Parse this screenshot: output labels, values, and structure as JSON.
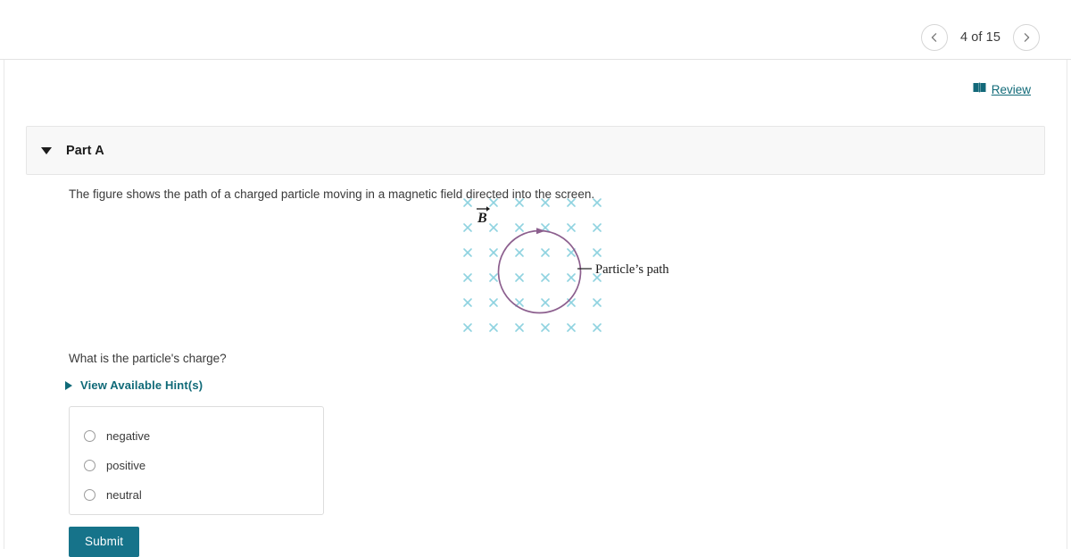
{
  "pager": {
    "prev_icon": "chevron-left-icon",
    "next_icon": "chevron-right-icon",
    "label": "4 of 15",
    "current": 4,
    "total": 15
  },
  "review": {
    "icon": "book-icon",
    "label": "Review"
  },
  "part": {
    "caret_icon": "caret-down-icon",
    "title": "Part A"
  },
  "question": {
    "statement": "The figure shows the path of a charged particle moving in a magnetic field directed into the screen.",
    "prompt": "What is the particle's charge?"
  },
  "hint": {
    "caret_icon": "caret-right-icon",
    "label": "View Available Hint(s)"
  },
  "figure": {
    "field_label": "B",
    "path_label": "Particle's path",
    "field_symbol": "×",
    "field_direction": "into-screen",
    "rotation": "clockwise",
    "grid_cols": 6,
    "grid_rows": 6,
    "x_color": "#8fd3e0",
    "path_color": "#8c5f8e",
    "label_color": "#1a1a1a"
  },
  "answers": {
    "options": [
      {
        "label": "negative",
        "selected": false
      },
      {
        "label": "positive",
        "selected": false
      },
      {
        "label": "neutral",
        "selected": false
      }
    ]
  },
  "actions": {
    "submit_label": "Submit",
    "submit_color": "#16738a"
  }
}
